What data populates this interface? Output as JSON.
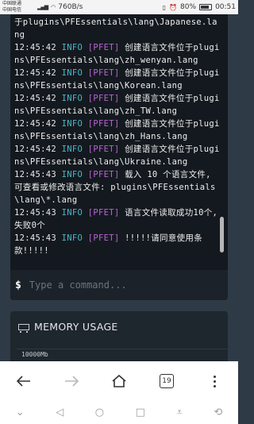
{
  "status_bar": {
    "carrier1": "中国联通",
    "carrier2": "中国电信",
    "network_speed": "760B/s",
    "battery": "80%",
    "time": "00:51"
  },
  "console": {
    "lines": [
      {
        "ts": "",
        "level": "",
        "tag": "",
        "msg": "于plugins\\PFEssentials\\lang\\Japanese.lang"
      },
      {
        "ts": "12:45:42",
        "level": "INFO",
        "tag": "[PFET]",
        "msg": "创建语言文件位于plugins\\PFEssentials\\lang\\zh_wenyan.lang"
      },
      {
        "ts": "12:45:42",
        "level": "INFO",
        "tag": "[PFET]",
        "msg": "创建语言文件位于plugins\\PFEssentials\\lang\\Korean.lang"
      },
      {
        "ts": "12:45:42",
        "level": "INFO",
        "tag": "[PFET]",
        "msg": "创建语言文件位于plugins\\PFEssentials\\lang\\zh_TW.lang"
      },
      {
        "ts": "12:45:42",
        "level": "INFO",
        "tag": "[PFET]",
        "msg": "创建语言文件位于plugins\\PFEssentials\\lang\\zh_Hans.lang"
      },
      {
        "ts": "12:45:42",
        "level": "INFO",
        "tag": "[PFET]",
        "msg": "创建语言文件位于plugins\\PFEssentials\\lang\\Ukraine.lang"
      },
      {
        "ts": "12:45:43",
        "level": "INFO",
        "tag": "[PFET]",
        "msg": "载入 10 个语言文件, 可查看或修改语言文件: plugins\\PFEssentials\\lang\\*.lang"
      },
      {
        "ts": "12:45:43",
        "level": "INFO",
        "tag": "[PFET]",
        "msg": "语言文件读取成功10个, 失败0个"
      },
      {
        "ts": "12:45:43",
        "level": "INFO",
        "tag": "[PFET]",
        "msg": "!!!!!请同意使用条款!!!!!"
      }
    ],
    "prompt": "$",
    "command_placeholder": "Type a command..."
  },
  "memory": {
    "title": "MEMORY USAGE",
    "icon": "memory-chip-icon",
    "axis_top": "10000Mb"
  },
  "browser": {
    "tab_count": "19",
    "icons": [
      "back-arrow-icon",
      "forward-arrow-icon",
      "home-icon",
      "tabs-icon",
      "menu-dots-icon"
    ]
  },
  "nav": {
    "icons": [
      "chevron-down-icon",
      "back-triangle-icon",
      "home-circle-icon",
      "recents-square-icon",
      "notification-pull-icon",
      "rotate-icon"
    ]
  },
  "colors": {
    "background": "#2e3a46",
    "console_bg": "#14191f",
    "level_info": "#49b7c9",
    "tag": "#bb62d6"
  }
}
